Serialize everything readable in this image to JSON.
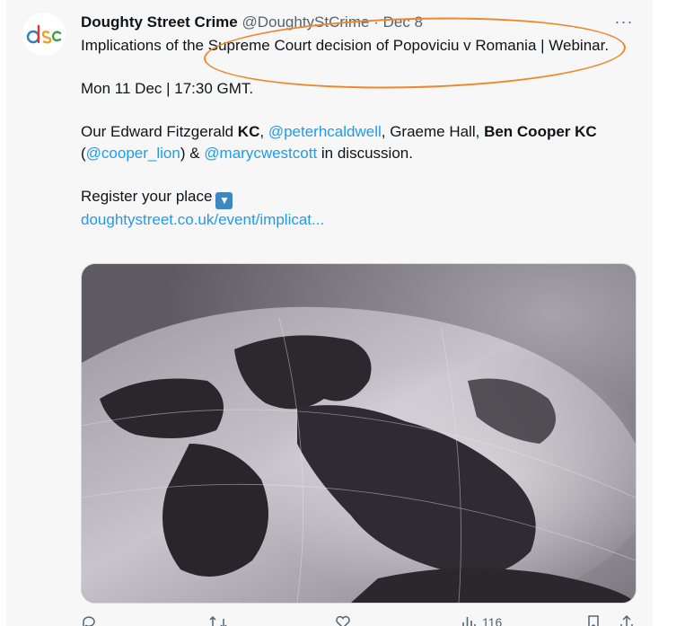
{
  "tweet": {
    "author_name": "Doughty Street Crime",
    "handle": "@DoughtyStCrime",
    "separator": "·",
    "date": "Dec 8",
    "avatar_text": "dsc",
    "title_line": "Implications of the Supreme Court decision of Popoviciu v Romania | Webinar.",
    "date_line": "Mon 11 Dec | 17:30 GMT.",
    "para": {
      "t1": "Our Edward Fitzgerald ",
      "b1": "KC",
      "t2": ", ",
      "m1": "@peterhcaldwell",
      "t3": ", Graeme Hall, ",
      "b2": "Ben Cooper KC",
      "t4": " (",
      "m2": "@cooper_lion",
      "t5": ") & ",
      "m3": "@marycwestcott",
      "t6": " in discussion."
    },
    "register_text": "Register your place",
    "register_emoji": "▼",
    "link": "doughtystreet.co.uk/event/implicat...",
    "more_icon": "···"
  },
  "actions": {
    "views": "116"
  },
  "colors": {
    "link": "#1d9bf0",
    "annotation": "#f0862a",
    "meta": "#536471"
  }
}
